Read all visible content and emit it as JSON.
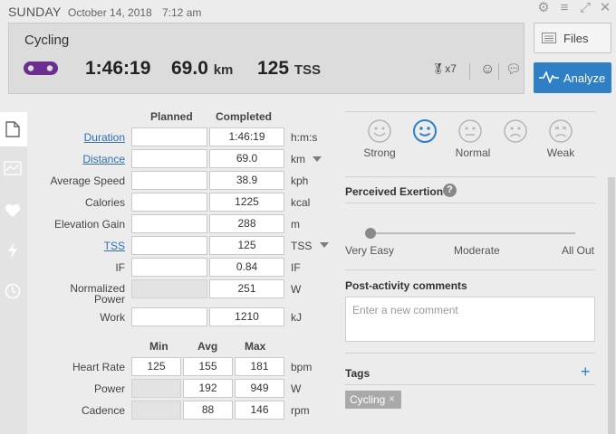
{
  "header": {
    "day": "SUNDAY",
    "date": "October 14, 2018",
    "time": "7:12 am"
  },
  "summary": {
    "sport": "Cycling",
    "duration": "1:46:19",
    "distance_value": "69.0",
    "distance_unit": "km",
    "tss_value": "125",
    "tss_unit": "TSS",
    "medal_count": "x7",
    "files_label": "Files",
    "analyze_label": "Analyze"
  },
  "metrics": {
    "col_planned": "Planned",
    "col_completed": "Completed",
    "rows": [
      {
        "label": "Duration",
        "completed": "1:46:19",
        "unit": "h:m:s"
      },
      {
        "label": "Distance",
        "completed": "69.0",
        "unit": "km"
      },
      {
        "label": "Average Speed",
        "completed": "38.9",
        "unit": "kph"
      },
      {
        "label": "Calories",
        "completed": "1225",
        "unit": "kcal"
      },
      {
        "label": "Elevation Gain",
        "completed": "288",
        "unit": "m"
      },
      {
        "label": "TSS",
        "completed": "125",
        "unit": "TSS"
      },
      {
        "label": "IF",
        "completed": "0.84",
        "unit": "IF"
      },
      {
        "label": "Normalized",
        "label2": "Power",
        "completed": "251",
        "unit": "W"
      },
      {
        "label": "Work",
        "completed": "1210",
        "unit": "kJ"
      }
    ]
  },
  "ranges": {
    "col_min": "Min",
    "col_avg": "Avg",
    "col_max": "Max",
    "rows": [
      {
        "label": "Heart Rate",
        "min": "125",
        "avg": "155",
        "max": "181",
        "unit": "bpm"
      },
      {
        "label": "Power",
        "min": "",
        "avg": "192",
        "max": "949",
        "unit": "W"
      },
      {
        "label": "Cadence",
        "min": "",
        "avg": "88",
        "max": "146",
        "unit": "rpm"
      }
    ]
  },
  "feel": {
    "options": [
      "Strong",
      "",
      "Normal",
      "",
      "Weak"
    ],
    "selected_index": 1
  },
  "exertion": {
    "title": "Perceived Exertion",
    "help": "?",
    "labels": [
      "Very Easy",
      "Moderate",
      "All Out"
    ],
    "value_fraction": 0
  },
  "comments": {
    "title": "Post-activity comments",
    "placeholder": "Enter a new comment"
  },
  "tags": {
    "title": "Tags",
    "add": "+",
    "items": [
      {
        "label": "Cycling",
        "remove": "×"
      }
    ]
  },
  "colors": {
    "accent": "#2f7fc7",
    "sport": "#6b2d8f",
    "link": "#2f6fb3"
  }
}
